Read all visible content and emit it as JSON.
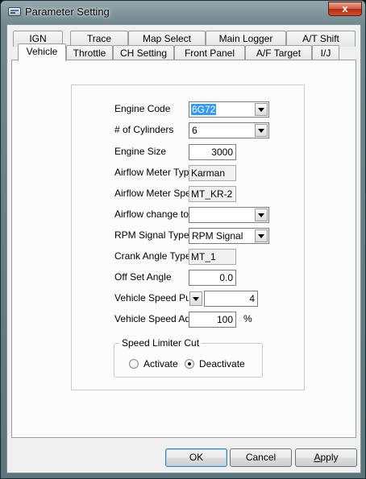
{
  "window": {
    "title": "Parameter Setting",
    "close_glyph": "x"
  },
  "tabs_row1": [
    {
      "label": "IGN"
    },
    {
      "label": "Trace"
    },
    {
      "label": "Map Select"
    },
    {
      "label": "Main Logger"
    },
    {
      "label": "A/T Shift"
    }
  ],
  "tabs_row2": [
    {
      "label": "Vehicle",
      "active": true
    },
    {
      "label": "Throttle"
    },
    {
      "label": "CH Setting"
    },
    {
      "label": "Front Panel"
    },
    {
      "label": "A/F Target"
    },
    {
      "label": "I/J"
    }
  ],
  "form": {
    "engine_code": {
      "label": "Engine Code",
      "value": "6G72"
    },
    "cylinders": {
      "label": "# of Cylinders",
      "value": "6"
    },
    "engine_size": {
      "label": "Engine Size",
      "value": "3000"
    },
    "airflow_type": {
      "label": "Airflow Meter Type",
      "value": "Karman"
    },
    "airflow_spec": {
      "label": "Airflow Meter Spec",
      "value": "MT_KR-2"
    },
    "airflow_change": {
      "label": "Airflow change to",
      "value": ""
    },
    "rpm_signal": {
      "label": "RPM Signal Type",
      "value": "RPM Signal"
    },
    "crank_angle": {
      "label": "Crank Angle Type",
      "value": "MT_1"
    },
    "offset_angle": {
      "label": "Off Set Angle",
      "value": "0.0"
    },
    "vs_pulse": {
      "label": "Vehicle Speed Puls",
      "value": "4"
    },
    "vs_adj": {
      "label": "Vehicle Speed Adj.",
      "value": "100",
      "unit": "%"
    }
  },
  "speed_limiter": {
    "legend": "Speed Limiter Cut",
    "options": [
      {
        "label": "Activate",
        "checked": false
      },
      {
        "label": "Deactivate",
        "checked": true
      }
    ]
  },
  "buttons": {
    "ok": "OK",
    "cancel": "Cancel",
    "apply_prefix": "",
    "apply_underlined": "A",
    "apply_rest": "pply"
  },
  "colors": {
    "selection": "#3399ff",
    "close_button": "#c8462b",
    "panel_bg": "#fcfcfc"
  }
}
